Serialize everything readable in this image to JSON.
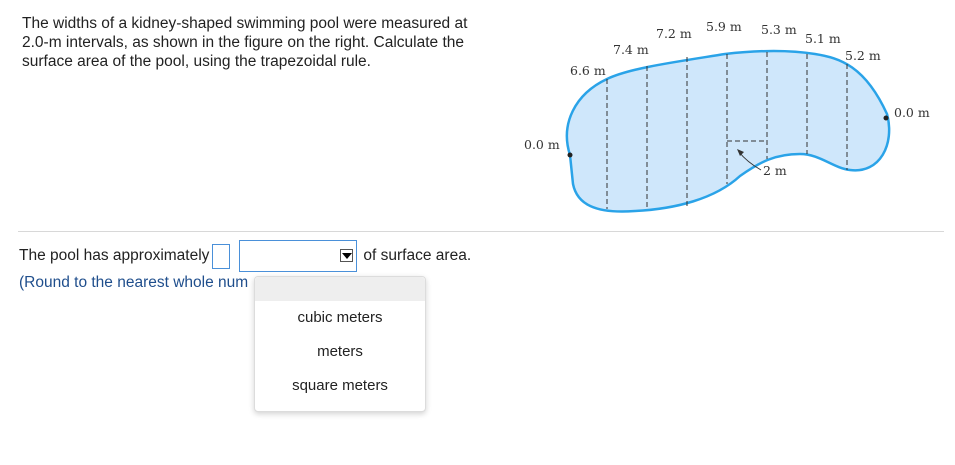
{
  "problem": {
    "line1": "The widths of a kidney-shaped swimming pool were measured at",
    "line2": "2.0-m intervals, as shown in the figure on the right. Calculate the",
    "line3": "surface area of the pool, using the trapezoidal rule."
  },
  "figure": {
    "widths": [
      "0.0 m",
      "6.6 m",
      "7.4 m",
      "7.2 m",
      "5.9 m",
      "5.3 m",
      "5.1 m",
      "5.2 m",
      "0.0 m"
    ],
    "interval_label": "2 m",
    "colors": {
      "fill": "#cfe7fb",
      "stroke": "#2aa3e8",
      "lines": "#333333"
    }
  },
  "answer": {
    "prefix": "The pool has approximately",
    "suffix": "of surface area.",
    "hint": "(Round to the nearest whole num",
    "value": "",
    "selected_unit": ""
  },
  "unit_options": [
    "cubic meters",
    "meters",
    "square meters"
  ]
}
